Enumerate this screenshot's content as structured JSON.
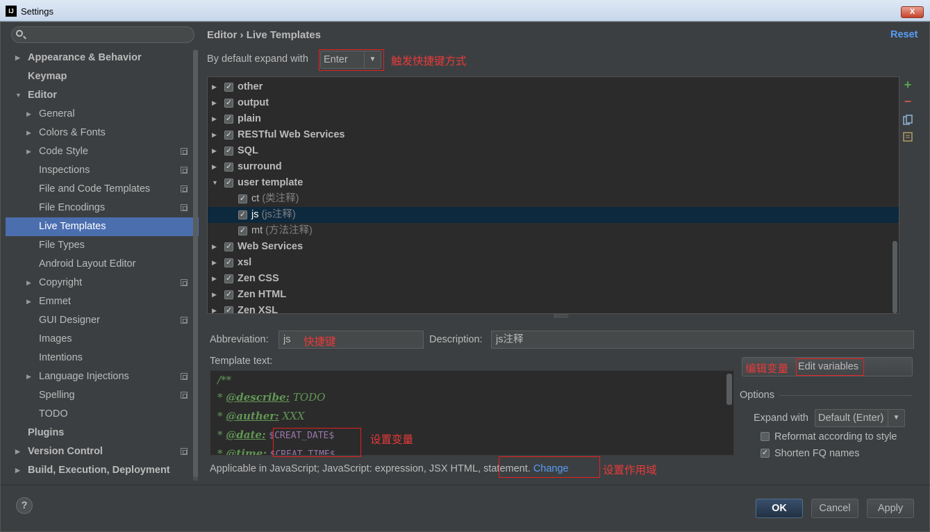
{
  "window": {
    "title": "Settings",
    "close_label": "X",
    "app_icon": "IJ"
  },
  "search": {
    "placeholder": ""
  },
  "sidebar": {
    "items": [
      {
        "label": "Appearance & Behavior"
      },
      {
        "label": "Keymap"
      },
      {
        "label": "Editor"
      },
      {
        "label": "General"
      },
      {
        "label": "Colors & Fonts"
      },
      {
        "label": "Code Style"
      },
      {
        "label": "Inspections"
      },
      {
        "label": "File and Code Templates"
      },
      {
        "label": "File Encodings"
      },
      {
        "label": "Live Templates"
      },
      {
        "label": "File Types"
      },
      {
        "label": "Android Layout Editor"
      },
      {
        "label": "Copyright"
      },
      {
        "label": "Emmet"
      },
      {
        "label": "GUI Designer"
      },
      {
        "label": "Images"
      },
      {
        "label": "Intentions"
      },
      {
        "label": "Language Injections"
      },
      {
        "label": "Spelling"
      },
      {
        "label": "TODO"
      },
      {
        "label": "Plugins"
      },
      {
        "label": "Version Control"
      },
      {
        "label": "Build, Execution, Deployment"
      }
    ]
  },
  "header": {
    "breadcrumb_parent": "Editor",
    "breadcrumb_sep": "›",
    "breadcrumb_current": "Live Templates",
    "reset_label": "Reset"
  },
  "expand": {
    "label": "By default expand with",
    "value": "Enter",
    "annotation": "触发快捷键方式"
  },
  "templates": {
    "rows": [
      {
        "label": "other",
        "desc": ""
      },
      {
        "label": "output",
        "desc": ""
      },
      {
        "label": "plain",
        "desc": ""
      },
      {
        "label": "RESTful Web Services",
        "desc": ""
      },
      {
        "label": "SQL",
        "desc": ""
      },
      {
        "label": "surround",
        "desc": ""
      },
      {
        "label": "user template",
        "desc": ""
      },
      {
        "label": "ct",
        "desc": "(类注释)"
      },
      {
        "label": "js",
        "desc": "(js注释)"
      },
      {
        "label": "mt",
        "desc": "(方法注释)"
      },
      {
        "label": "Web Services",
        "desc": ""
      },
      {
        "label": "xsl",
        "desc": ""
      },
      {
        "label": "Zen CSS",
        "desc": ""
      },
      {
        "label": "Zen HTML",
        "desc": ""
      },
      {
        "label": "Zen XSL",
        "desc": ""
      }
    ]
  },
  "toolbar": {
    "add_icon": "+",
    "remove_icon": "−"
  },
  "abbreviation": {
    "label": "Abbreviation:",
    "value": "js",
    "annotation": "快捷键"
  },
  "description": {
    "label": "Description:",
    "value": "js注释"
  },
  "template_text": {
    "label": "Template text:",
    "line1": "/**",
    "line2_star": "* ",
    "line2_tag": "@describe:",
    "line2_val": " TODO",
    "line3_star": "* ",
    "line3_tag": "@auther:",
    "line3_val": " XXX",
    "line4_star": "* ",
    "line4_tag": "@date:",
    "line4_var": "$CREAT_DATE$",
    "line5_star": "* ",
    "line5_tag": "@time:",
    "line5_var": "$CREAT_TIME$",
    "var_annotation": "设置变量"
  },
  "edit_variables": {
    "label": "Edit variables",
    "annotation": "编辑变量"
  },
  "options": {
    "title": "Options",
    "expand_label": "Expand with",
    "expand_value": "Default (Enter)",
    "reformat_label": "Reformat according to style",
    "reformat_checked": false,
    "shorten_label": "Shorten FQ names",
    "shorten_checked": true
  },
  "applicable": {
    "text": "Applicable in JavaScript; JavaScript: expression, JSX HTML, statement.",
    "change_label": "Change",
    "annotation": "设置作用域"
  },
  "buttons": {
    "ok": "OK",
    "cancel": "Cancel",
    "apply": "Apply",
    "help": "?"
  },
  "colors": {
    "selection": "#4b6eaf",
    "link": "#589df6",
    "annotation_red": "#e83a3a",
    "list_selection": "#0d293e"
  }
}
